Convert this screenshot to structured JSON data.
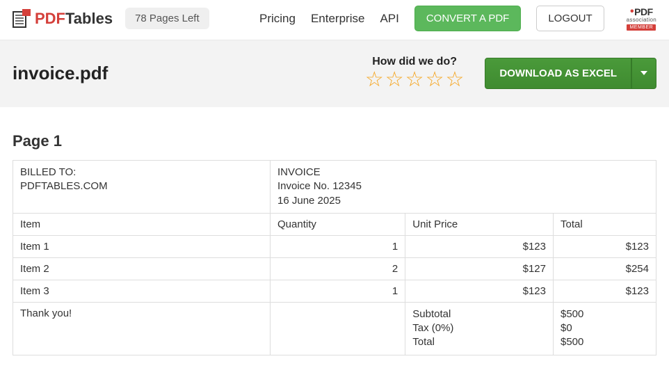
{
  "header": {
    "logo_red": "PDF",
    "logo_gray": "Tables",
    "pages_left": "78 Pages Left",
    "nav": {
      "pricing": "Pricing",
      "enterprise": "Enterprise",
      "api": "API"
    },
    "convert": "CONVERT A PDF",
    "logout": "LOGOUT",
    "assoc": {
      "top": "PDF",
      "mid": "association",
      "mem": "MEMBER"
    }
  },
  "subhead": {
    "filename": "invoice.pdf",
    "rating_q": "How did we do?",
    "download": "DOWNLOAD AS EXCEL"
  },
  "page": {
    "heading": "Page 1",
    "billed_label": "BILLED TO:",
    "billed_to": "PDFTABLES.COM",
    "inv_label": "INVOICE",
    "inv_no": "Invoice No. 12345",
    "inv_date": "16 June 2025",
    "cols": {
      "item": "Item",
      "qty": "Quantity",
      "unit": "Unit Price",
      "total": "Total"
    },
    "rows": [
      {
        "item": "Item 1",
        "qty": "1",
        "unit": "$123",
        "total": "$123"
      },
      {
        "item": "Item 2",
        "qty": "2",
        "unit": "$127",
        "total": "$254"
      },
      {
        "item": "Item 3",
        "qty": "1",
        "unit": "$123",
        "total": "$123"
      }
    ],
    "thank": "Thank you!",
    "summary": {
      "subtotal_l": "Subtotal",
      "subtotal_v": "$500",
      "tax_l": "Tax (0%)",
      "tax_v": "$0",
      "total_l": "Total",
      "total_v": "$500"
    }
  }
}
